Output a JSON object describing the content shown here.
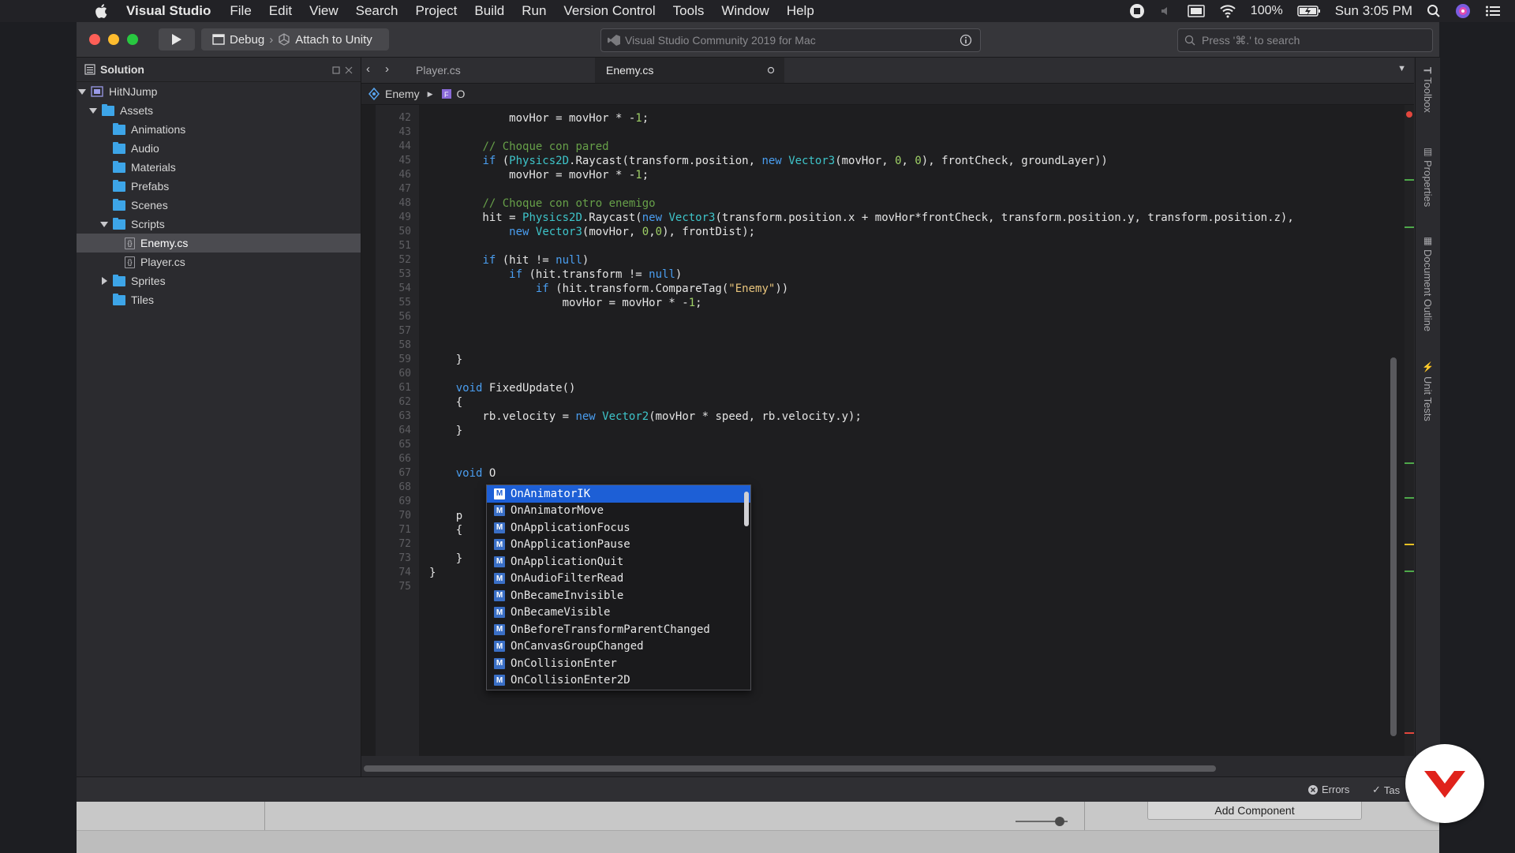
{
  "menubar": {
    "app_name": "Visual Studio",
    "items": [
      "File",
      "Edit",
      "View",
      "Search",
      "Project",
      "Build",
      "Run",
      "Version Control",
      "Tools",
      "Window",
      "Help"
    ],
    "battery": "100%",
    "clock": "Sun 3:05 PM"
  },
  "toolbar": {
    "config": "Debug",
    "target": "Attach to Unity",
    "status": "Visual Studio Community 2019 for Mac",
    "search_placeholder": "Press '⌘.' to search"
  },
  "solution": {
    "title": "Solution",
    "tree": [
      {
        "label": "HitNJump",
        "kind": "solution",
        "indent": 0,
        "expanded": true
      },
      {
        "label": "Assets",
        "kind": "folder",
        "indent": 1,
        "expanded": true
      },
      {
        "label": "Animations",
        "kind": "folder",
        "indent": 2
      },
      {
        "label": "Audio",
        "kind": "folder",
        "indent": 2
      },
      {
        "label": "Materials",
        "kind": "folder",
        "indent": 2
      },
      {
        "label": "Prefabs",
        "kind": "folder",
        "indent": 2
      },
      {
        "label": "Scenes",
        "kind": "folder",
        "indent": 2
      },
      {
        "label": "Scripts",
        "kind": "folder",
        "indent": 2,
        "expanded": true
      },
      {
        "label": "Enemy.cs",
        "kind": "file",
        "indent": 3,
        "selected": true
      },
      {
        "label": "Player.cs",
        "kind": "file",
        "indent": 3
      },
      {
        "label": "Sprites",
        "kind": "folder",
        "indent": 2,
        "collapsed": true
      },
      {
        "label": "Tiles",
        "kind": "folder",
        "indent": 2
      }
    ]
  },
  "tabs": [
    {
      "label": "Player.cs",
      "active": false
    },
    {
      "label": "Enemy.cs",
      "active": true
    }
  ],
  "breadcrumb": {
    "class_name": "Enemy",
    "member": "O"
  },
  "code": {
    "lines": [
      {
        "n": "42",
        "t": "            movHor = movHor * -1;"
      },
      {
        "n": "43",
        "t": ""
      },
      {
        "n": "44",
        "t": "        // Choque con pared"
      },
      {
        "n": "45",
        "t": "        if (Physics2D.Raycast(transform.position, new Vector3(movHor, 0, 0), frontCheck, groundLayer))"
      },
      {
        "n": "46",
        "t": "            movHor = movHor * -1;"
      },
      {
        "n": "47",
        "t": ""
      },
      {
        "n": "48",
        "t": "        // Choque con otro enemigo"
      },
      {
        "n": "49",
        "t": "        hit = Physics2D.Raycast(new Vector3(transform.position.x + movHor*frontCheck, transform.position.y, transform.position.z),"
      },
      {
        "n": "50",
        "t": "            new Vector3(movHor, 0,0), frontDist);"
      },
      {
        "n": "51",
        "t": ""
      },
      {
        "n": "52",
        "t": "        if (hit != null)"
      },
      {
        "n": "53",
        "t": "            if (hit.transform != null)"
      },
      {
        "n": "54",
        "t": "                if (hit.transform.CompareTag(\"Enemy\"))"
      },
      {
        "n": "55",
        "t": "                    movHor = movHor * -1;"
      },
      {
        "n": "56",
        "t": ""
      },
      {
        "n": "57",
        "t": ""
      },
      {
        "n": "58",
        "t": ""
      },
      {
        "n": "59",
        "t": "    }"
      },
      {
        "n": "60",
        "t": ""
      },
      {
        "n": "61",
        "t": "    void FixedUpdate()"
      },
      {
        "n": "62",
        "t": "    {"
      },
      {
        "n": "63",
        "t": "        rb.velocity = new Vector2(movHor * speed, rb.velocity.y);"
      },
      {
        "n": "64",
        "t": "    }"
      },
      {
        "n": "65",
        "t": ""
      },
      {
        "n": "66",
        "t": ""
      },
      {
        "n": "67",
        "t": "    void O"
      },
      {
        "n": "68",
        "t": ""
      },
      {
        "n": "69",
        "t": ""
      },
      {
        "n": "70",
        "t": "    p"
      },
      {
        "n": "71",
        "t": "    {"
      },
      {
        "n": "72",
        "t": ""
      },
      {
        "n": "73",
        "t": "    }"
      },
      {
        "n": "74",
        "t": "}"
      },
      {
        "n": "75",
        "t": ""
      }
    ]
  },
  "autocomplete": {
    "badge": "M",
    "items": [
      "OnAnimatorIK",
      "OnAnimatorMove",
      "OnApplicationFocus",
      "OnApplicationPause",
      "OnApplicationQuit",
      "OnAudioFilterRead",
      "OnBecameInvisible",
      "OnBecameVisible",
      "OnBeforeTransformParentChanged",
      "OnCanvasGroupChanged",
      "OnCollisionEnter",
      "OnCollisionEnter2D"
    ],
    "selected_index": 0
  },
  "right_pads": [
    "Toolbox",
    "Properties",
    "Document Outline",
    "Unit Tests"
  ],
  "statusbar": {
    "errors": "Errors",
    "tasks": "Tas"
  },
  "unity_panel": {
    "add_component": "Add Component"
  },
  "colors": {
    "accent": "#1d5fd6",
    "folder": "#3da5e8",
    "logo_red": "#e0221b"
  }
}
